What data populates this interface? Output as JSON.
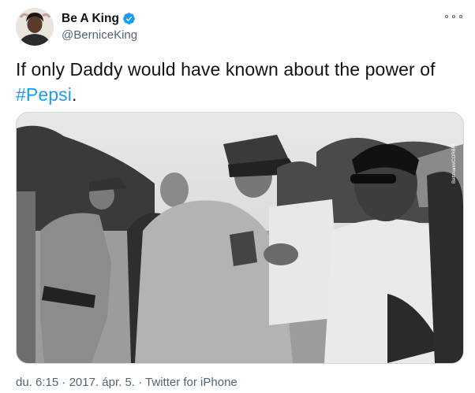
{
  "author": {
    "display_name": "Be A King",
    "handle": "@BerniceKing",
    "verified": true,
    "avatar_icon": "profile-photo"
  },
  "tweet": {
    "text_before": "If only Daddy would have known about the power of ",
    "hashtag": "#Pepsi",
    "text_after": ".",
    "image_watermark": "Bettmann/CORBIS"
  },
  "meta": {
    "time": "du. 6:15",
    "separator": " · ",
    "date": "2017. ápr. 5.",
    "source": "Twitter for iPhone"
  },
  "colors": {
    "link": "#1d9bf0",
    "verified": "#1d9bf0",
    "secondary_text": "#536471"
  }
}
